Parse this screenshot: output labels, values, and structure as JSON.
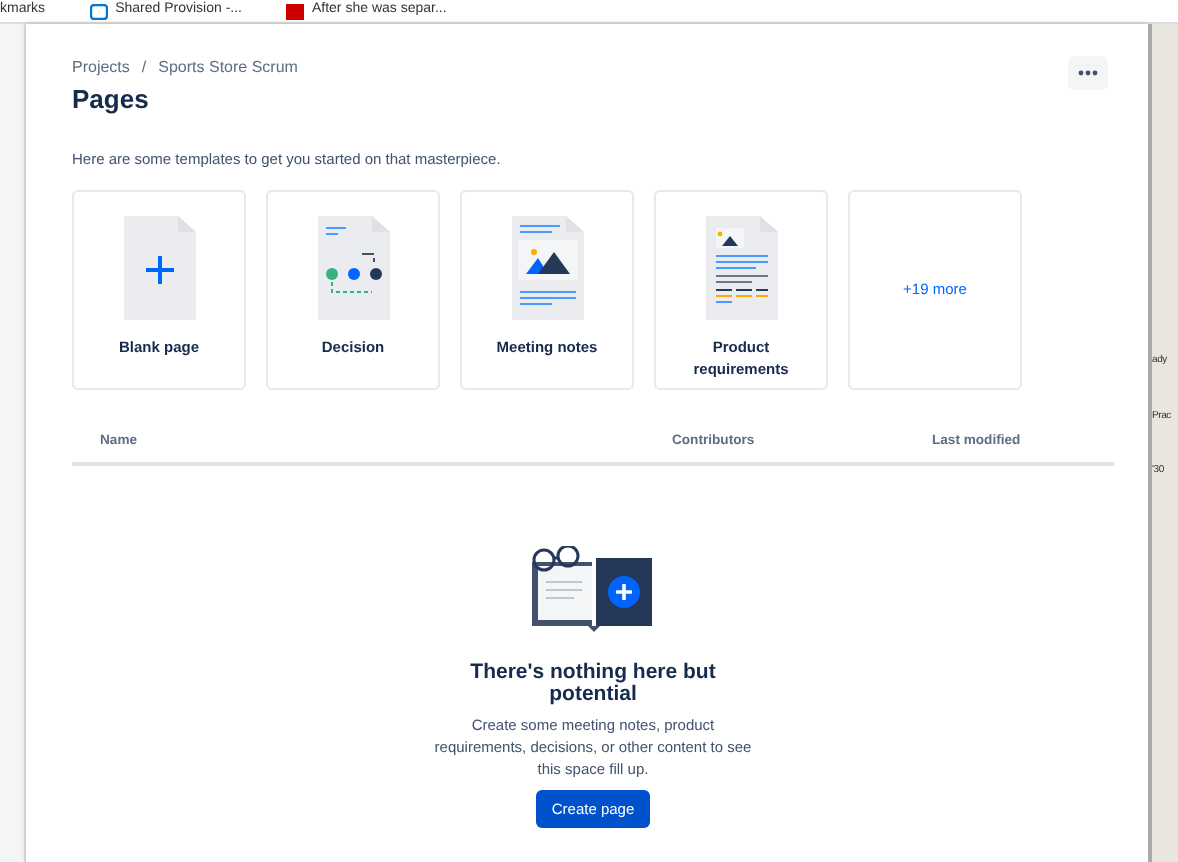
{
  "bookmarks_bar": {
    "items": [
      {
        "label": "kmarks",
        "kind": "folder"
      },
      {
        "label": "Shared Provision -...",
        "kind": "cloud"
      },
      {
        "label": "After she was separ...",
        "kind": "news"
      }
    ]
  },
  "background_window": {
    "texts": [
      "ady",
      "Prac",
      "'30"
    ]
  },
  "breadcrumbs": {
    "items": [
      "Projects",
      "Sports Store Scrum"
    ],
    "separator": "/"
  },
  "page_title": "Pages",
  "intro": "Here are some templates to get you started on that masterpiece.",
  "templates": [
    {
      "kind": "blank",
      "label": "Blank page"
    },
    {
      "kind": "decision",
      "label": "Decision"
    },
    {
      "kind": "meeting",
      "label": "Meeting notes"
    },
    {
      "kind": "product",
      "label": "Product requirements"
    },
    {
      "kind": "more",
      "label": "+19 more"
    }
  ],
  "table": {
    "columns": [
      "Name",
      "Contributors",
      "Last modified"
    ]
  },
  "empty_state": {
    "title": "There's nothing here but potential",
    "text": "Create some meeting notes, product requirements, decisions, or other content to see this space fill up.",
    "button": "Create page"
  }
}
